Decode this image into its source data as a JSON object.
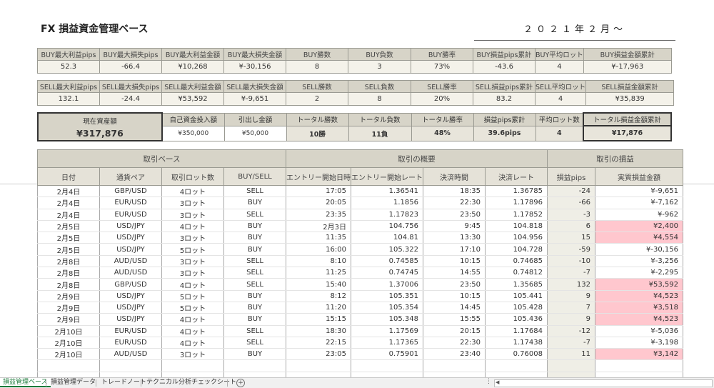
{
  "header": {
    "title": "FX 損益資金管理ベース",
    "date": "２０２１年２月～"
  },
  "buy_stats": {
    "headers": [
      "BUY最大利益pips",
      "BUY最大損失pips",
      "BUY最大利益金額",
      "BUY最大損失金額",
      "BUY勝数",
      "BUY負数",
      "BUY勝率",
      "BUY損益pips累計",
      "BUY平均ロット",
      "BUY損益金額累計"
    ],
    "values": [
      "52.3",
      "-66.4",
      "¥10,268",
      "¥-30,156",
      "8",
      "3",
      "73%",
      "-43.6",
      "4",
      "¥-17,963"
    ]
  },
  "sell_stats": {
    "headers": [
      "SELL最大利益pips",
      "SELL最大損失pips",
      "SELL最大利益金額",
      "SELL最大損失金額",
      "SELL勝数",
      "SELL負数",
      "SELL勝率",
      "SELL損益pips累計",
      "SELL平均ロット",
      "SELL損益金額累計"
    ],
    "values": [
      "132.1",
      "-24.4",
      "¥53,592",
      "¥-9,651",
      "2",
      "8",
      "20%",
      "83.2",
      "4",
      "¥35,839"
    ]
  },
  "summary": {
    "current_label": "現在資産額",
    "current_value": "¥317,876",
    "deposit_label": "自己資金投入額",
    "deposit_value": "¥350,000",
    "withdraw_label": "引出し金額",
    "withdraw_value": "¥50,000",
    "total_wins_label": "トータル勝数",
    "total_wins": "10勝",
    "total_losses_label": "トータル負数",
    "total_losses": "11負",
    "total_rate_label": "トータル勝率",
    "total_rate": "48%",
    "pips_total_label": "損益pips累計",
    "pips_total": "39.6pips",
    "avg_lot_label": "平均ロット数",
    "avg_lot": "4",
    "amount_total_label": "トータル損益金額累計",
    "amount_total": "¥17,876"
  },
  "trade_table": {
    "groups": [
      "取引ベース",
      "取引の概要",
      "取引の損益"
    ],
    "columns": [
      "日付",
      "通貨ペア",
      "取引ロット数",
      "BUY/SELL",
      "エントリー開始日時",
      "エントリー開始レート",
      "決済時間",
      "決済レート",
      "損益pips",
      "実質損益金額"
    ],
    "rows": [
      [
        "2月4日",
        "GBP/USD",
        "4ロット",
        "SELL",
        "17:05",
        "1.36541",
        "18:35",
        "1.36785",
        "-24",
        "¥-9,651"
      ],
      [
        "2月4日",
        "EUR/USD",
        "3ロット",
        "BUY",
        "20:05",
        "1.1856",
        "22:30",
        "1.17896",
        "-66",
        "¥-7,162"
      ],
      [
        "2月4日",
        "EUR/USD",
        "3ロット",
        "SELL",
        "23:35",
        "1.17823",
        "23:50",
        "1.17852",
        "-3",
        "¥-962"
      ],
      [
        "2月5日",
        "USD/JPY",
        "4ロット",
        "BUY",
        "2月3日",
        "104.756",
        "9:45",
        "104.818",
        "6",
        "¥2,400"
      ],
      [
        "2月5日",
        "USD/JPY",
        "3ロット",
        "BUY",
        "11:35",
        "104.81",
        "13:30",
        "104.956",
        "15",
        "¥4,554"
      ],
      [
        "2月5日",
        "USD/JPY",
        "5ロット",
        "BUY",
        "16:00",
        "105.322",
        "17:10",
        "104.728",
        "-59",
        "¥-30,156"
      ],
      [
        "2月8日",
        "AUD/USD",
        "3ロット",
        "SELL",
        "8:10",
        "0.74585",
        "10:15",
        "0.74685",
        "-10",
        "¥-3,256"
      ],
      [
        "2月8日",
        "AUD/USD",
        "3ロット",
        "SELL",
        "11:25",
        "0.74745",
        "14:55",
        "0.74812",
        "-7",
        "¥-2,295"
      ],
      [
        "2月8日",
        "GBP/USD",
        "4ロット",
        "SELL",
        "15:40",
        "1.37006",
        "23:50",
        "1.35685",
        "132",
        "¥53,592"
      ],
      [
        "2月9日",
        "USD/JPY",
        "5ロット",
        "BUY",
        "8:12",
        "105.351",
        "10:15",
        "105.441",
        "9",
        "¥4,523"
      ],
      [
        "2月9日",
        "USD/JPY",
        "5ロット",
        "BUY",
        "11:20",
        "105.354",
        "14:45",
        "105.428",
        "7",
        "¥3,518"
      ],
      [
        "2月9日",
        "USD/JPY",
        "4ロット",
        "BUY",
        "15:15",
        "105.348",
        "15:55",
        "105.436",
        "9",
        "¥4,523"
      ],
      [
        "2月10日",
        "EUR/USD",
        "4ロット",
        "SELL",
        "18:30",
        "1.17569",
        "20:15",
        "1.17684",
        "-12",
        "¥-5,036"
      ],
      [
        "2月10日",
        "EUR/USD",
        "4ロット",
        "SELL",
        "22:15",
        "1.17365",
        "22:30",
        "1.17438",
        "-7",
        "¥-3,198"
      ],
      [
        "2月10日",
        "AUD/USD",
        "3ロット",
        "BUY",
        "23:05",
        "0.75901",
        "23:40",
        "0.76008",
        "11",
        "¥3,142"
      ]
    ],
    "positive_rows": [
      3,
      4,
      8,
      9,
      10,
      11,
      14
    ],
    "empty_rows": 2
  },
  "sheet_tabs": [
    "損益管理ベース",
    "損益管理データ",
    "トレードノート",
    "テクニカル分析チェックシート"
  ],
  "colors": {
    "header_bg": "#d7d4c8",
    "positive_bg": "#ffc7ce",
    "active_tab": "#1a7a3a"
  }
}
